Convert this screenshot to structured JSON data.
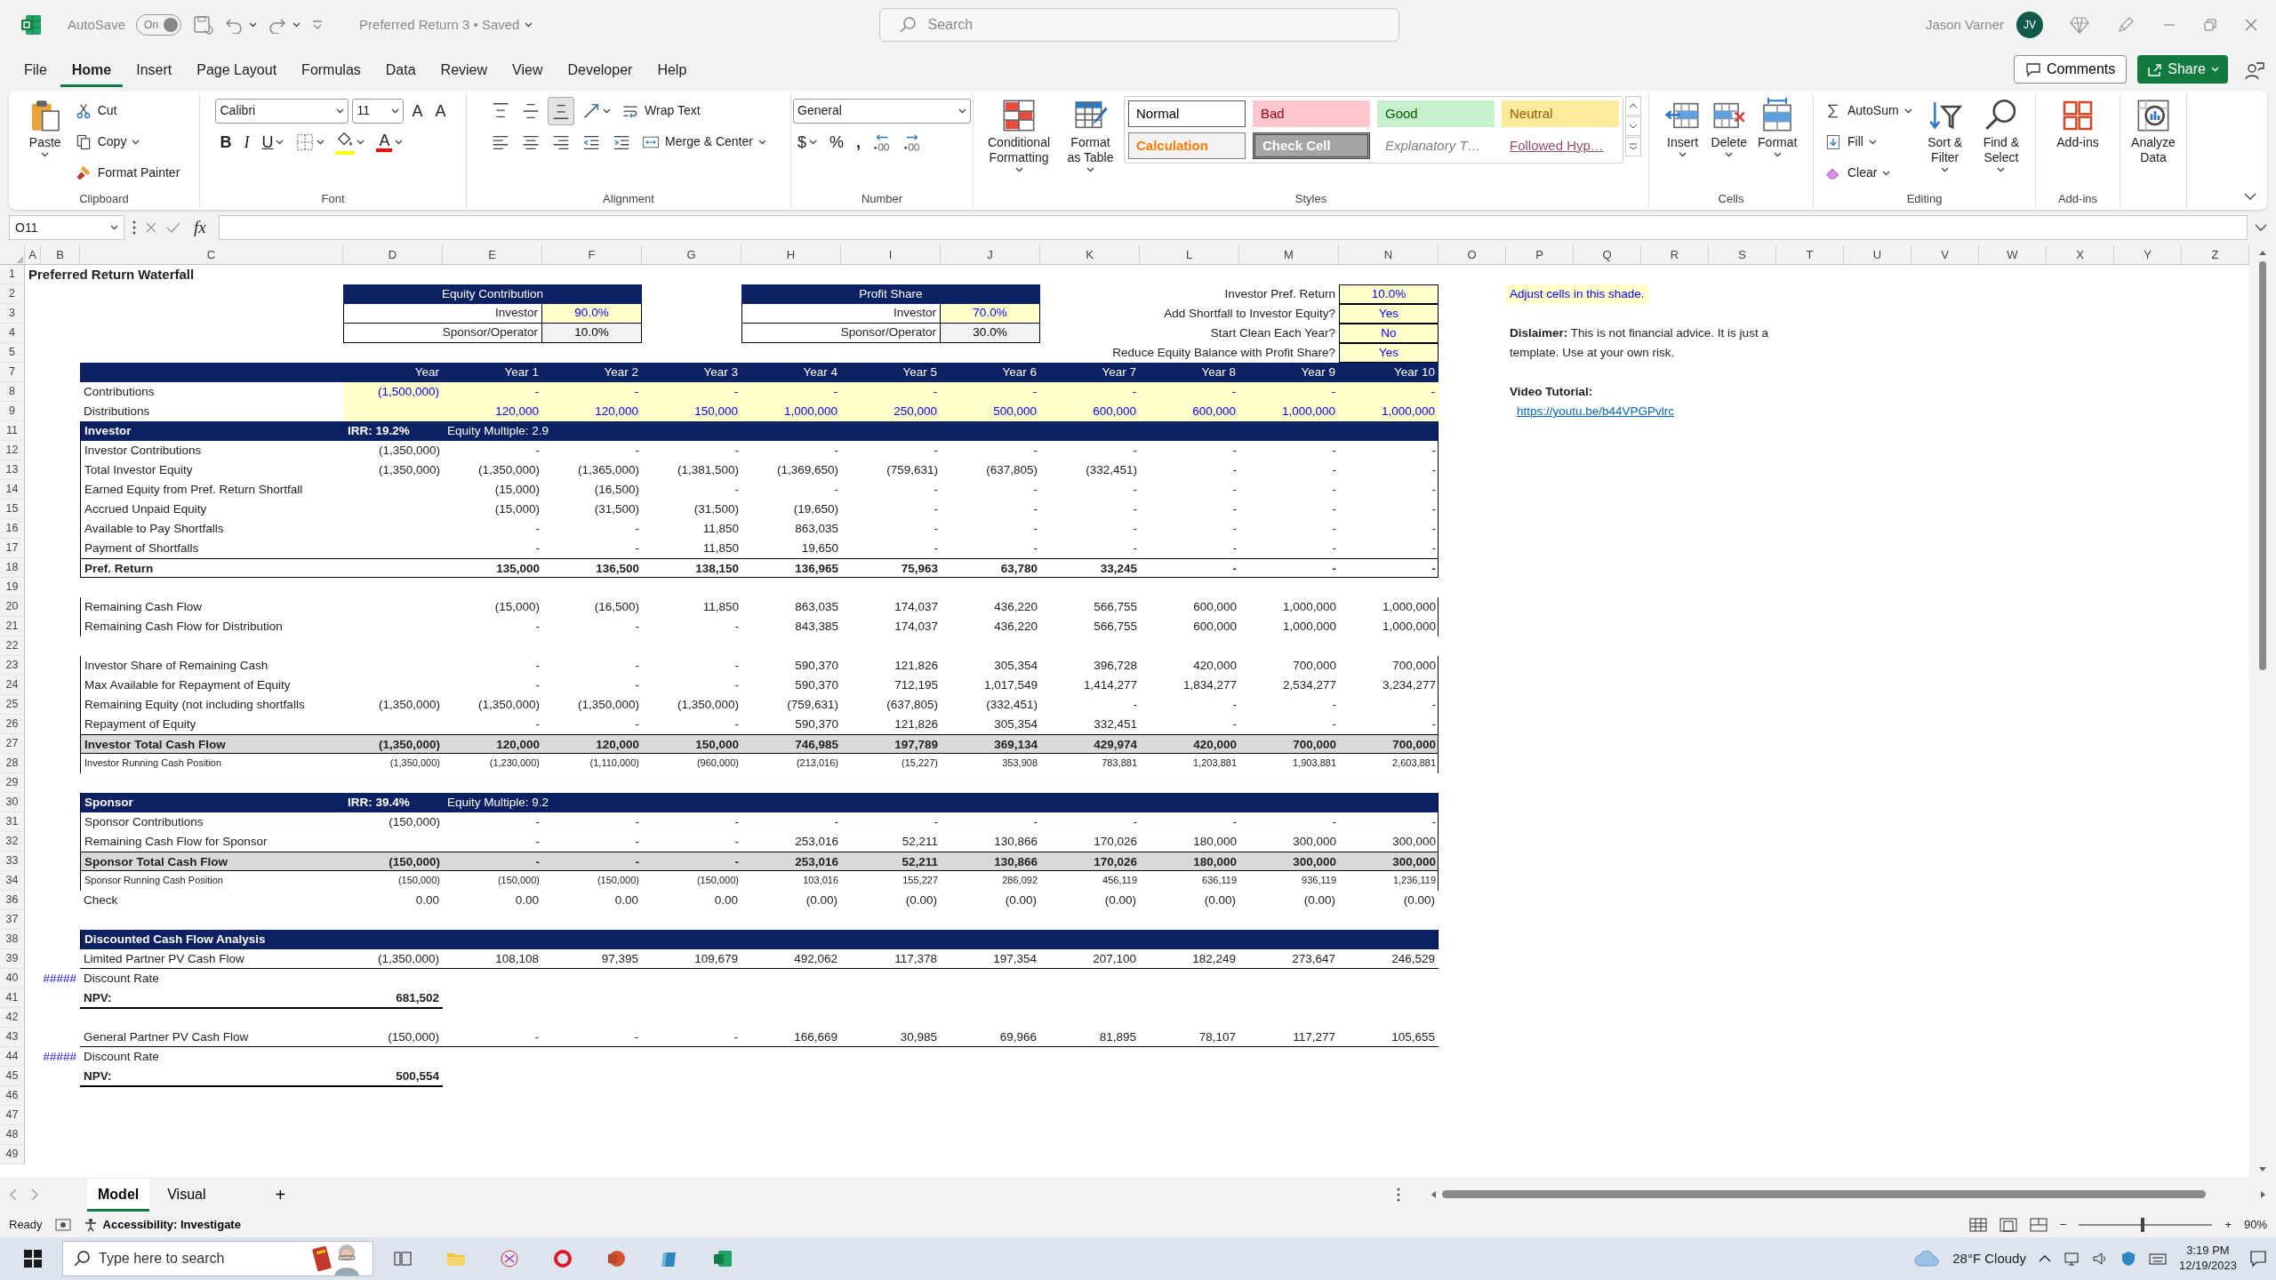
{
  "title_bar": {
    "autosave_label": "AutoSave",
    "autosave_state": "On",
    "autosave_on": true,
    "document_title": "Preferred Return 3 • Saved",
    "search_placeholder": "Search",
    "user_name": "Jason Varner",
    "user_initials": "JV"
  },
  "menu_tabs": [
    {
      "label": "File",
      "selected": false
    },
    {
      "label": "Home",
      "selected": true
    },
    {
      "label": "Insert",
      "selected": false
    },
    {
      "label": "Page Layout",
      "selected": false
    },
    {
      "label": "Formulas",
      "selected": false
    },
    {
      "label": "Data",
      "selected": false
    },
    {
      "label": "Review",
      "selected": false
    },
    {
      "label": "View",
      "selected": false
    },
    {
      "label": "Developer",
      "selected": false
    },
    {
      "label": "Help",
      "selected": false
    }
  ],
  "comments_button": "Comments",
  "share_button": "Share",
  "ribbon": [
    {
      "label": "Clipboard",
      "items": [
        {
          "kind": "large",
          "label": "Paste",
          "caret": true
        },
        {
          "kind": "stack",
          "lines": [
            {
              "items": [
                {
                  "kind": "small",
                  "label": "Cut"
                }
              ]
            },
            {
              "items": [
                {
                  "kind": "small",
                  "label": "Copy",
                  "caret": true
                }
              ]
            },
            {
              "items": [
                {
                  "kind": "small",
                  "label": "Format Painter"
                }
              ]
            }
          ]
        }
      ]
    },
    {
      "label": "Font",
      "items": [
        {
          "kind": "stack",
          "lines": [
            {
              "items": [
                {
                  "kind": "select",
                  "value": "Calibri"
                },
                {
                  "kind": "select",
                  "value": "11"
                },
                {
                  "kind": "glyph",
                  "label": "A"
                },
                {
                  "kind": "glyph",
                  "label": "A"
                }
              ]
            },
            {
              "items": [
                {
                  "kind": "glyph",
                  "label": "B",
                  "bold": true
                },
                {
                  "kind": "glyph",
                  "label": "I",
                  "italic": true
                },
                {
                  "kind": "glyph",
                  "label": "U",
                  "underline": true,
                  "caret": true
                },
                {
                  "kind": "icon",
                  "caret": true
                },
                {
                  "kind": "icon",
                  "caret": true,
                  "color": "#ffff00"
                },
                {
                  "kind": "glyph",
                  "label": "A",
                  "caret": true,
                  "color": "#ff0000"
                }
              ]
            }
          ]
        }
      ]
    },
    {
      "label": "Alignment",
      "items": [
        {
          "kind": "stack",
          "lines": [
            {
              "items": [
                {
                  "kind": "icon",
                  "selected": false
                },
                {
                  "kind": "icon",
                  "selected": false
                },
                {
                  "kind": "icon",
                  "selected": true
                },
                {
                  "kind": "icon",
                  "caret": true
                },
                {
                  "kind": "small",
                  "label": "Wrap Text"
                }
              ]
            },
            {
              "items": [
                {
                  "kind": "icon",
                  "selected": false
                },
                {
                  "kind": "icon",
                  "selected": false
                },
                {
                  "kind": "icon",
                  "selected": false
                },
                {
                  "kind": "icon"
                },
                {
                  "kind": "icon"
                },
                {
                  "kind": "small",
                  "label": "Merge & Center",
                  "caret": true
                }
              ]
            }
          ]
        }
      ]
    },
    {
      "label": "Number",
      "items": [
        {
          "kind": "stack",
          "lines": [
            {
              "items": [
                {
                  "kind": "select",
                  "value": "General"
                }
              ]
            },
            {
              "items": [
                {
                  "kind": "glyph",
                  "label": "$",
                  "caret": true
                },
                {
                  "kind": "glyph",
                  "label": "%"
                },
                {
                  "kind": "glyph",
                  "label": ",",
                  "bold": true
                },
                {
                  "kind": "icon"
                },
                {
                  "kind": "icon"
                }
              ]
            }
          ]
        }
      ]
    },
    {
      "label": "Styles",
      "items": [
        {
          "kind": "large",
          "label": "Conditional Formatting",
          "caret": true
        },
        {
          "kind": "large",
          "label": "Format as Table",
          "caret": true
        },
        {
          "kind": "gallery",
          "styles": [
            {
              "kind": "normal",
              "label": "Normal"
            },
            {
              "kind": "bad",
              "label": "Bad"
            },
            {
              "kind": "good",
              "label": "Good"
            },
            {
              "kind": "neutral",
              "label": "Neutral"
            },
            {
              "kind": "calculation",
              "label": "Calculation"
            },
            {
              "kind": "check",
              "label": "Check Cell"
            },
            {
              "kind": "explanatory",
              "label": "Explanatory T…"
            },
            {
              "kind": "hyperlink",
              "label": "Followed Hyp…"
            }
          ]
        }
      ]
    },
    {
      "label": "Cells",
      "items": [
        {
          "kind": "large",
          "label": "Insert",
          "caret": true
        },
        {
          "kind": "large",
          "label": "Delete",
          "caret": true
        },
        {
          "kind": "large",
          "label": "Format",
          "caret": true
        }
      ]
    },
    {
      "label": "Editing",
      "items": [
        {
          "kind": "stack",
          "lines": [
            {
              "items": [
                {
                  "kind": "small",
                  "label": "AutoSum",
                  "caret": true
                }
              ]
            },
            {
              "items": [
                {
                  "kind": "small",
                  "label": "Fill",
                  "caret": true
                }
              ]
            },
            {
              "items": [
                {
                  "kind": "small",
                  "label": "Clear",
                  "caret": true
                }
              ]
            }
          ]
        },
        {
          "kind": "large",
          "label": "Sort & Filter",
          "caret": true
        },
        {
          "kind": "large",
          "label": "Find & Select",
          "caret": true
        }
      ]
    },
    {
      "label": "Add-ins",
      "items": [
        {
          "kind": "large",
          "label": "Add-ins"
        }
      ]
    },
    {
      "items": [
        {
          "kind": "large",
          "label": "Analyze Data"
        }
      ]
    }
  ],
  "formula_bar": {
    "name_box": "O11",
    "function_label": "fx"
  },
  "sheet": {
    "columns": [
      "A",
      "B",
      "C",
      "D",
      "E",
      "F",
      "G",
      "H",
      "I",
      "J",
      "K",
      "L",
      "M",
      "N",
      "O",
      "P",
      "Q",
      "R",
      "S",
      "T",
      "U",
      "V",
      "W",
      "X",
      "Y",
      "Z"
    ],
    "rows": [
      {
        "number": "1",
        "title": "Preferred Return Waterfall"
      },
      {
        "number": "2",
        "boxes": [
          {
            "kind": "heading",
            "text": "Equity Contribution"
          },
          {
            "kind": "heading",
            "text": "Profit Share"
          }
        ],
        "setting": {
          "label": "Investor Pref. Return",
          "value": "10.0%"
        },
        "side": {
          "kind": "note",
          "text": "Adjust cells in this shade."
        }
      },
      {
        "number": "3",
        "boxes": [
          {
            "kind": "entry",
            "label": "Investor",
            "value": "90.0%",
            "input": true
          },
          {
            "kind": "entry",
            "label": "Investor",
            "value": "70.0%",
            "input": true
          }
        ],
        "setting": {
          "label": "Add Shortfall to Investor Equity?",
          "value": "Yes"
        }
      },
      {
        "number": "4",
        "boxes": [
          {
            "kind": "entry",
            "label": "Sponsor/Operator",
            "value": "10.0%",
            "input": false
          },
          {
            "kind": "entry",
            "label": "Sponsor/Operator",
            "value": "30.0%",
            "input": false
          }
        ],
        "setting": {
          "label": "Start Clean Each Year?",
          "value": "No"
        },
        "side": {
          "kind": "text",
          "text": "**Dislaimer:** This is not financial advice. It is just a template. Use at your own risk."
        }
      },
      {
        "number": "5",
        "setting": {
          "label": "Reduce Equity Balance with Profit Share?",
          "value": "Yes"
        }
      },
      {
        "number": "7",
        "kind": "header",
        "values": [
          "Year",
          "Year 1",
          "Year 2",
          "Year 3",
          "Year 4",
          "Year 5",
          "Year 6",
          "Year 7",
          "Year 8",
          "Year 9",
          "Year 10"
        ]
      },
      {
        "number": "8",
        "kind": "input",
        "label": "Contributions",
        "values": [
          "(1,500,000)",
          "-",
          "-",
          "-",
          "-",
          "-",
          "-",
          "-",
          "-",
          "-",
          "-"
        ],
        "side": {
          "kind": "heading",
          "text": "Video Tutorial:"
        }
      },
      {
        "number": "9",
        "kind": "input",
        "label": "Distributions",
        "values": [
          "120,000",
          "120,000",
          "150,000",
          "1,000,000",
          "250,000",
          "500,000",
          "600,000",
          "600,000",
          "1,000,000",
          "1,000,000"
        ],
        "side": {
          "kind": "link",
          "text": "https://youtu.be/b44VPGPvlrc"
        }
      },
      {
        "number": "11",
        "kind": "section",
        "label": "Investor",
        "irr": "IRR: 19.2%",
        "multiple": "Equity Multiple: 2.9"
      },
      {
        "number": "12",
        "kind": "line",
        "label": "Investor Contributions",
        "values": [
          "(1,350,000)",
          "-",
          "-",
          "-",
          "-",
          "-",
          "-",
          "-",
          "-",
          "-",
          "-"
        ]
      },
      {
        "number": "13",
        "kind": "line",
        "label": "Total Investor Equity",
        "values": [
          "(1,350,000)",
          "(1,350,000)",
          "(1,365,000)",
          "(1,381,500)",
          "(1,369,650)",
          "(759,631)",
          "(637,805)",
          "(332,451)",
          "-",
          "-",
          "-"
        ]
      },
      {
        "number": "14",
        "kind": "line",
        "label": "Earned Equity from Pref. Return Shortfall",
        "values": [
          "(15,000)",
          "(16,500)",
          "-",
          "-",
          "-",
          "-",
          "-",
          "-",
          "-",
          "-"
        ]
      },
      {
        "number": "15",
        "kind": "line",
        "label": "Accrued Unpaid Equity",
        "values": [
          "(15,000)",
          "(31,500)",
          "(31,500)",
          "(19,650)",
          "-",
          "-",
          "-",
          "-",
          "-",
          "-"
        ]
      },
      {
        "number": "16",
        "kind": "line",
        "label": "Available to Pay Shortfalls",
        "values": [
          "-",
          "-",
          "11,850",
          "863,035",
          "-",
          "-",
          "-",
          "-",
          "-",
          "-"
        ]
      },
      {
        "number": "17",
        "kind": "line",
        "label": "Payment of Shortfalls",
        "values": [
          "-",
          "-",
          "11,850",
          "19,650",
          "-",
          "-",
          "-",
          "-",
          "-",
          "-"
        ]
      },
      {
        "number": "18",
        "kind": "subtotal",
        "label": "Pref. Return",
        "values": [
          "135,000",
          "136,500",
          "138,150",
          "136,965",
          "75,963",
          "63,780",
          "33,245",
          "-",
          "-",
          "-"
        ]
      },
      {
        "number": "19"
      },
      {
        "number": "20",
        "kind": "line",
        "label": "Remaining Cash Flow",
        "values": [
          "(15,000)",
          "(16,500)",
          "11,850",
          "863,035",
          "174,037",
          "436,220",
          "566,755",
          "600,000",
          "1,000,000",
          "1,000,000"
        ]
      },
      {
        "number": "21",
        "kind": "line",
        "label": "Remaining Cash Flow for Distribution",
        "values": [
          "-",
          "-",
          "-",
          "843,385",
          "174,037",
          "436,220",
          "566,755",
          "600,000",
          "1,000,000",
          "1,000,000"
        ]
      },
      {
        "number": "22"
      },
      {
        "number": "23",
        "kind": "line",
        "label": "Investor Share of Remaining Cash",
        "values": [
          "-",
          "-",
          "-",
          "590,370",
          "121,826",
          "305,354",
          "396,728",
          "420,000",
          "700,000",
          "700,000"
        ]
      },
      {
        "number": "24",
        "kind": "line",
        "label": "Max Available for Repayment of Equity",
        "values": [
          "-",
          "-",
          "-",
          "590,370",
          "712,195",
          "1,017,549",
          "1,414,277",
          "1,834,277",
          "2,534,277",
          "3,234,277"
        ]
      },
      {
        "number": "25",
        "kind": "line",
        "label": "Remaining Equity (not including shortfalls",
        "values": [
          "(1,350,000)",
          "(1,350,000)",
          "(1,350,000)",
          "(1,350,000)",
          "(759,631)",
          "(637,805)",
          "(332,451)",
          "-",
          "-",
          "-",
          "-"
        ]
      },
      {
        "number": "26",
        "kind": "line",
        "label": "Repayment of Equity",
        "values": [
          "-",
          "-",
          "-",
          "590,370",
          "121,826",
          "305,354",
          "332,451",
          "-",
          "-",
          "-"
        ]
      },
      {
        "number": "27",
        "kind": "total",
        "label": "Investor Total Cash Flow",
        "values": [
          "(1,350,000)",
          "120,000",
          "120,000",
          "150,000",
          "746,985",
          "197,789",
          "369,134",
          "429,974",
          "420,000",
          "700,000",
          "700,000"
        ]
      },
      {
        "number": "28",
        "kind": "running",
        "label": "Investor Running Cash Position",
        "values": [
          "(1,350,000)",
          "(1,230,000)",
          "(1,110,000)",
          "(960,000)",
          "(213,016)",
          "(15,227)",
          "353,908",
          "783,881",
          "1,203,881",
          "1,903,881",
          "2,603,881"
        ]
      },
      {
        "number": "29"
      },
      {
        "number": "30",
        "kind": "section",
        "label": "Sponsor",
        "irr": "IRR: 39.4%",
        "multiple": "Equity Multiple: 9.2"
      },
      {
        "number": "31",
        "kind": "line",
        "label": "Sponsor Contributions",
        "values": [
          "(150,000)",
          "-",
          "-",
          "-",
          "-",
          "-",
          "-",
          "-",
          "-",
          "-",
          "-"
        ]
      },
      {
        "number": "32",
        "kind": "line",
        "label": "Remaining Cash Flow for Sponsor",
        "values": [
          "-",
          "-",
          "-",
          "253,016",
          "52,211",
          "130,866",
          "170,026",
          "180,000",
          "300,000",
          "300,000"
        ]
      },
      {
        "number": "33",
        "kind": "total",
        "label": "Sponsor Total Cash Flow",
        "values": [
          "(150,000)",
          "-",
          "-",
          "-",
          "253,016",
          "52,211",
          "130,866",
          "170,026",
          "180,000",
          "300,000",
          "300,000"
        ]
      },
      {
        "number": "34",
        "kind": "running",
        "label": "Sponsor Running Cash Position",
        "values": [
          "(150,000)",
          "(150,000)",
          "(150,000)",
          "(150,000)",
          "103,016",
          "155,227",
          "286,092",
          "456,119",
          "636,119",
          "936,119",
          "1,236,119"
        ]
      },
      {
        "number": "36",
        "kind": "check",
        "label": "Check",
        "values": [
          "0.00",
          "0.00",
          "0.00",
          "0.00",
          "(0.00)",
          "(0.00)",
          "(0.00)",
          "(0.00)",
          "(0.00)",
          "(0.00)",
          "(0.00)"
        ]
      },
      {
        "number": "37"
      },
      {
        "number": "38",
        "kind": "section",
        "label": "Discounted Cash Flow Analysis"
      },
      {
        "number": "39",
        "kind": "pv",
        "label": "Limited Partner PV Cash Flow",
        "values": [
          "(1,350,000)",
          "108,108",
          "97,395",
          "109,679",
          "492,062",
          "117,378",
          "197,354",
          "207,100",
          "182,249",
          "273,647",
          "246,529"
        ]
      },
      {
        "number": "40",
        "kind": "rate",
        "marker": "#####",
        "label": "Discount Rate"
      },
      {
        "number": "41",
        "kind": "npv",
        "label": "NPV:",
        "value": "681,502"
      },
      {
        "number": "42"
      },
      {
        "number": "43",
        "kind": "pv",
        "label": "General Partner PV Cash Flow",
        "values": [
          "(150,000)",
          "-",
          "-",
          "-",
          "166,669",
          "30,985",
          "69,966",
          "81,895",
          "78,107",
          "117,277",
          "105,655"
        ]
      },
      {
        "number": "44",
        "kind": "rate",
        "marker": "#####",
        "label": "Discount Rate"
      },
      {
        "number": "45",
        "kind": "npv",
        "label": "NPV:",
        "value": "500,554"
      },
      {
        "number": "46"
      },
      {
        "number": "47"
      },
      {
        "number": "48"
      },
      {
        "number": "49"
      }
    ]
  },
  "sheet_tabs": [
    {
      "label": "Model",
      "selected": true
    },
    {
      "label": "Visual",
      "selected": false
    }
  ],
  "add_sheet": "+",
  "status_bar": {
    "ready": "Ready",
    "accessibility": "Accessibility: Investigate",
    "zoom_out": "−",
    "zoom_in": "+",
    "zoom": {
      "level": 0.48,
      "reading": "90%"
    }
  },
  "taskbar": {
    "search_placeholder": "Type here to search",
    "weather": "28°F Cloudy",
    "time": "3:19 PM",
    "date": "12/19/2023"
  }
}
